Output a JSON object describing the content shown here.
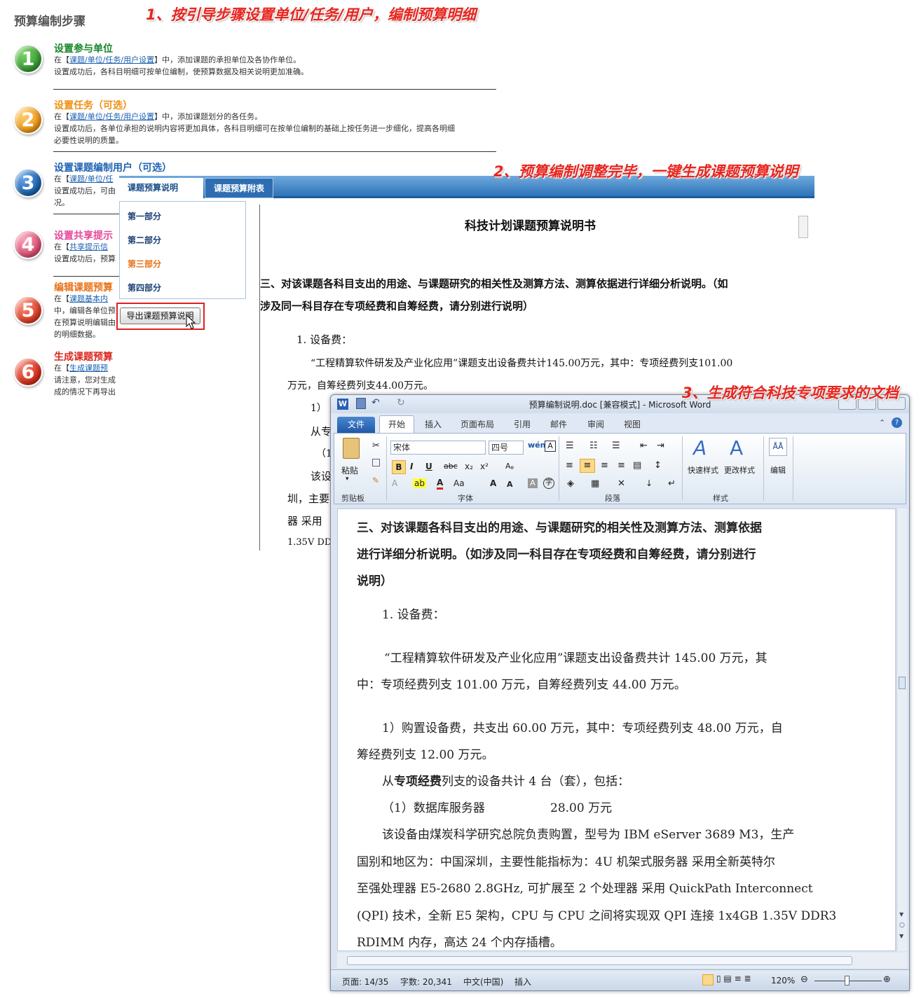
{
  "steps_panel": {
    "title": "预算编制步骤",
    "steps": [
      {
        "num": "1",
        "color": "#3aa136",
        "title_color": "#18862a",
        "title": "设置参与单位",
        "line1_pre": "在【",
        "link": "课题/单位/任务/用户设置",
        "line1_post": "】中，添加课题的承担单位及各协作单位。",
        "line2": "设置成功后，各科目明细可按单位编制，使预算数据及相关说明更加准确。",
        "line3": ""
      },
      {
        "num": "2",
        "color": "#ef9b1a",
        "title_color": "#ef8f12",
        "title": "设置任务（可选）",
        "line1_pre": "在【",
        "link": "课题/单位/任务/用户设置",
        "line1_post": "】中，添加课题划分的各任务。",
        "line2": "设置成功后，各单位承担的说明内容将更加具体，各科目明细可在按单位编制的基础上按任务进一步细化，提高各明细",
        "line3": "必要性说明的质量。"
      },
      {
        "num": "3",
        "color": "#1f68b4",
        "title_color": "#1d63b2",
        "title": "设置课题编制用户（可选）",
        "line1_pre": "在【",
        "link": "课题/单位/任",
        "line1_post": "",
        "line2": "设置成功后，可由",
        "line3": "况。"
      },
      {
        "num": "4",
        "color": "#e0567a",
        "title_color": "#e6489a",
        "title": "设置共享提示",
        "line1_pre": "在【",
        "link": "共享提示信",
        "line1_post": "",
        "line2": "设置成功后，预算",
        "line3": ""
      },
      {
        "num": "5",
        "color": "#e0422a",
        "title_color": "#e8721a",
        "title": "编辑课题预算",
        "line1_pre": "在【",
        "link": "课题基本内",
        "line1_post": "",
        "line2": "中，编辑各单位预",
        "line3": "在预算说明编辑由"
      },
      {
        "num": "6",
        "color": "#d9331f",
        "title_color": "#d9271d",
        "title": "生成课题预算",
        "line1_pre": "在【",
        "link": "生成课题预",
        "line1_post": "",
        "line2": "请注意，您对生成",
        "line3": "成的情况下再导出"
      }
    ],
    "step5_extra": "的明细数据。"
  },
  "captions": {
    "c1": "1、按引导步骤设置单位/任务/用户，编制预算明细",
    "c2": "2、预算编制调整完毕，一键生成课题预算说明",
    "c3": "3、生成符合科技专项要求的文档"
  },
  "budget_panel": {
    "tabs": [
      "课题预算说明",
      "课题预算附表"
    ],
    "menu": [
      "第一部分",
      "第二部分",
      "第三部分",
      "第四部分"
    ],
    "export_button": "导出课题预算说明",
    "doc_title": "科技计划课题预算说明书",
    "heading_line1": "三、对该课题各科目支出的用途、与课题研究的相关性及测算方法、测算依据进行详细分析说明。（如",
    "heading_line2": "涉及同一科目存在专项经费和自筹经费，请分别进行说明）",
    "item1": "1. 设备费：",
    "para1_line1": "“工程精算软件研发及产业化应用”课题支出设备费共计145.00万元，其中：专项经费列支101.00",
    "para1_line2": "万元，自筹经费列支44.00万元。",
    "frag1": "1）",
    "frag2": "从专",
    "frag3": "（1",
    "frag4": "该设",
    "frag5": "圳，主要",
    "frag6": "器 采用",
    "frag7": "1.35V DD"
  },
  "word": {
    "title": "预算编制说明.doc [兼容模式] - Microsoft Word",
    "file_tab": "文件",
    "tabs": [
      "开始",
      "插入",
      "页面布局",
      "引用",
      "邮件",
      "审阅",
      "视图"
    ],
    "groups": [
      "剪贴板",
      "字体",
      "段落",
      "样式",
      "编辑"
    ],
    "paste": "粘贴",
    "font_name": "宋体",
    "font_size": "四号",
    "quick_styles": "快速样式",
    "change_styles": "更改样式",
    "edit": "编辑",
    "doc_lines": {
      "h1": "三、对该课题各科目支出的用途、与课题研究的相关性及测算方法、测算依据",
      "h2": "进行详细分析说明。（如涉及同一科目存在专项经费和自筹经费，请分别进行",
      "h3": "说明）",
      "item1": "1. 设备费：",
      "p1a": "“工程精算软件研发及产业化应用”课题支出设备费共计 145.00 万元，其",
      "p1b": "中：专项经费列支 101.00 万元，自筹经费列支 44.00 万元。",
      "p2a": "1）购置设备费，共支出 60.00 万元，其中：专项经费列支 48.00 万元，自",
      "p2b": "筹经费列支 12.00 万元。",
      "p3_pre": "从",
      "p3_bold": "专项经费",
      "p3_post": "列支的设备共计 4 台（套），包括：",
      "p4_label": "（1）数据库服务器",
      "p4_value": "28.00 万元",
      "p5a": "该设备由煤炭科学研究总院负责购置，型号为 IBM  eServer 3689 M3，生产",
      "p5b": "国别和地区为：中国深圳，主要性能指标为：4U 机架式服务器 采用全新英特尔",
      "p5c": "至强处理器 E5-2680 2.8GHz, 可扩展至 2 个处理器 采用 QuickPath Interconnect",
      "p5d": "(QPI) 技术，全新 E5 架构，CPU 与 CPU 之间将实现双 QPI 连接 1x4GB 1.35V DDR3",
      "p5e": "RDIMM 内存，高达 24 个内存插槽。"
    },
    "status": {
      "page": "页面: 14/35",
      "words": "字数: 20,341",
      "lang": "中文(中国)",
      "mode": "插入",
      "zoom": "120%"
    }
  }
}
